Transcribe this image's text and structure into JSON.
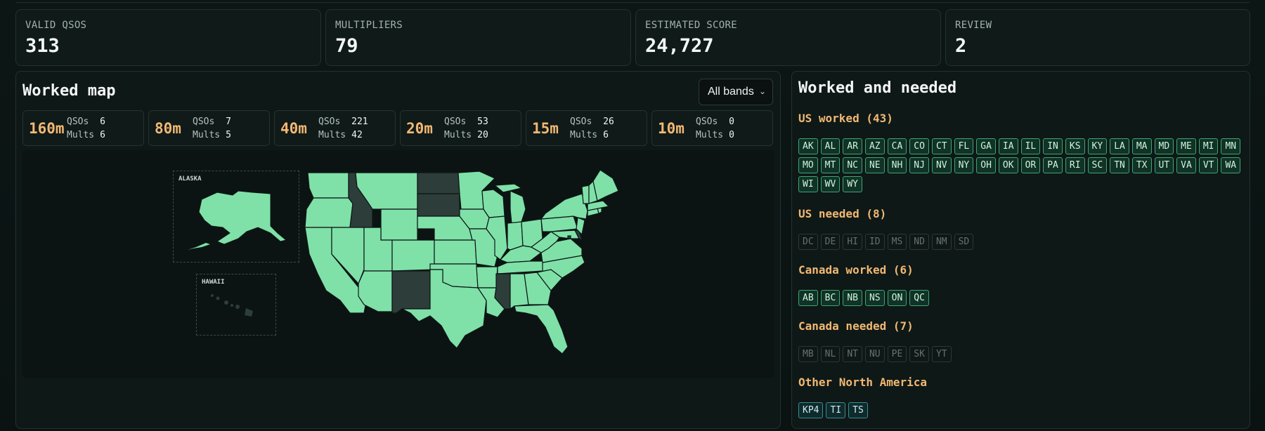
{
  "stats": [
    {
      "label": "VALID QSOS",
      "value": "313"
    },
    {
      "label": "MULTIPLIERS",
      "value": "79"
    },
    {
      "label": "ESTIMATED SCORE",
      "value": "24,727"
    },
    {
      "label": "REVIEW",
      "value": "2"
    }
  ],
  "map_panel": {
    "title": "Worked map",
    "band_filter": {
      "selected": "All bands"
    },
    "bands": [
      {
        "name": "160m",
        "qsos_label": "QSOs",
        "qsos": "6",
        "mults_label": "Mults",
        "mults": "6"
      },
      {
        "name": "80m",
        "qsos_label": "QSOs",
        "qsos": "7",
        "mults_label": "Mults",
        "mults": "5"
      },
      {
        "name": "40m",
        "qsos_label": "QSOs",
        "qsos": "221",
        "mults_label": "Mults",
        "mults": "42"
      },
      {
        "name": "20m",
        "qsos_label": "QSOs",
        "qsos": "53",
        "mults_label": "Mults",
        "mults": "20"
      },
      {
        "name": "15m",
        "qsos_label": "QSOs",
        "qsos": "26",
        "mults_label": "Mults",
        "mults": "6"
      },
      {
        "name": "10m",
        "qsos_label": "QSOs",
        "qsos": "0",
        "mults_label": "Mults",
        "mults": "0"
      }
    ],
    "insets": {
      "alaska": "ALASKA",
      "hawaii": "HAWAII"
    },
    "colors": {
      "worked": "#7fe1a8",
      "needed": "#2d3d3a",
      "border": "#0d1716"
    }
  },
  "needed_panel": {
    "title": "Worked and needed",
    "us_worked_title": "US worked (43)",
    "us_worked": [
      "AK",
      "AL",
      "AR",
      "AZ",
      "CA",
      "CO",
      "CT",
      "FL",
      "GA",
      "IA",
      "IL",
      "IN",
      "KS",
      "KY",
      "LA",
      "MA",
      "MD",
      "ME",
      "MI",
      "MN",
      "MO",
      "MT",
      "NC",
      "NE",
      "NH",
      "NJ",
      "NV",
      "NY",
      "OH",
      "OK",
      "OR",
      "PA",
      "RI",
      "SC",
      "TN",
      "TX",
      "UT",
      "VA",
      "VT",
      "WA",
      "WI",
      "WV",
      "WY"
    ],
    "us_needed_title": "US needed (8)",
    "us_needed": [
      "DC",
      "DE",
      "HI",
      "ID",
      "MS",
      "ND",
      "NM",
      "SD"
    ],
    "ca_worked_title": "Canada worked (6)",
    "ca_worked": [
      "AB",
      "BC",
      "NB",
      "NS",
      "ON",
      "QC"
    ],
    "ca_needed_title": "Canada needed (7)",
    "ca_needed": [
      "MB",
      "NL",
      "NT",
      "NU",
      "PE",
      "SK",
      "YT"
    ],
    "other_title": "Other North America",
    "other": [
      "KP4",
      "TI",
      "TS"
    ]
  }
}
